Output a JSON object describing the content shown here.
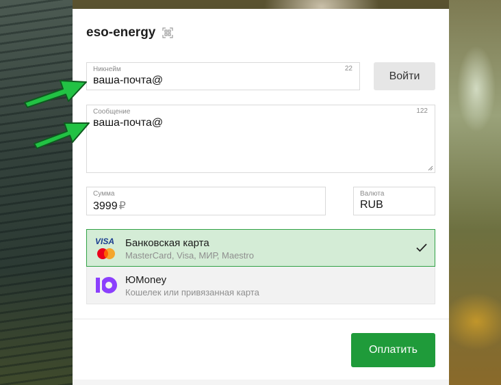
{
  "brand": {
    "name": "eso-energy",
    "icon": "qr-scan-icon"
  },
  "nickname_field": {
    "label": "Никнейм",
    "counter": "22",
    "value": "ваша-почта@"
  },
  "login_button": {
    "label": "Войти"
  },
  "message_field": {
    "label": "Сообщение",
    "counter": "122",
    "value": "ваша-почта@"
  },
  "amount_field": {
    "label": "Сумма",
    "value": "3999",
    "currency_symbol": "₽"
  },
  "currency_field": {
    "label": "Валюта",
    "value": "RUB"
  },
  "payment_methods": [
    {
      "title": "Банковская карта",
      "subtitle": "MasterCard, Visa, МИР, Maestro",
      "logo_text": "VISA",
      "selected": true
    },
    {
      "title": "ЮMoney",
      "subtitle": "Кошелек или привязанная карта",
      "selected": false
    }
  ],
  "pay_button": {
    "label": "Оплатить"
  },
  "colors": {
    "accent_green": "#1f9b3a",
    "selected_bg": "#d4ecd6",
    "arrow_green": "#22c244"
  }
}
